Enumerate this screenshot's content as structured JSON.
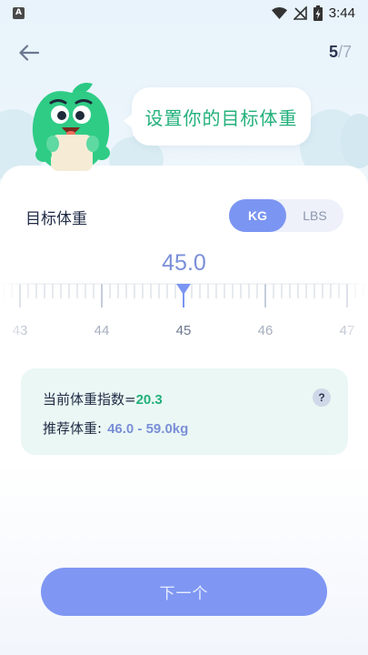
{
  "status_bar": {
    "app_badge": "A",
    "time": "3:44",
    "icons": [
      "wifi-icon",
      "no-signal-icon",
      "battery-charging-icon"
    ]
  },
  "header": {
    "back_icon": "arrow-left-icon",
    "step_current": "5",
    "step_separator": "/",
    "step_total": "7"
  },
  "mascot": {
    "bubble_text": "设置你的目标体重"
  },
  "target_weight": {
    "title": "目标体重",
    "units": [
      "KG",
      "LBS"
    ],
    "selected_unit": "KG",
    "value": "45.0",
    "ruler_labels": [
      "43",
      "44",
      "45",
      "46",
      "47"
    ],
    "ruler_selected": 45.0
  },
  "bmi_info": {
    "bmi_label": "当前体重指数=",
    "bmi_value": "20.3",
    "range_label": "推荐体重:",
    "range_value": "46.0 - 59.0kg",
    "help_icon": "?"
  },
  "next_button": {
    "label": "下一个"
  },
  "colors": {
    "accent": "#7b95f2",
    "green": "#22b07a",
    "bmi_card_bg": "#eaf7f4",
    "text_dark": "#1f2a44"
  }
}
